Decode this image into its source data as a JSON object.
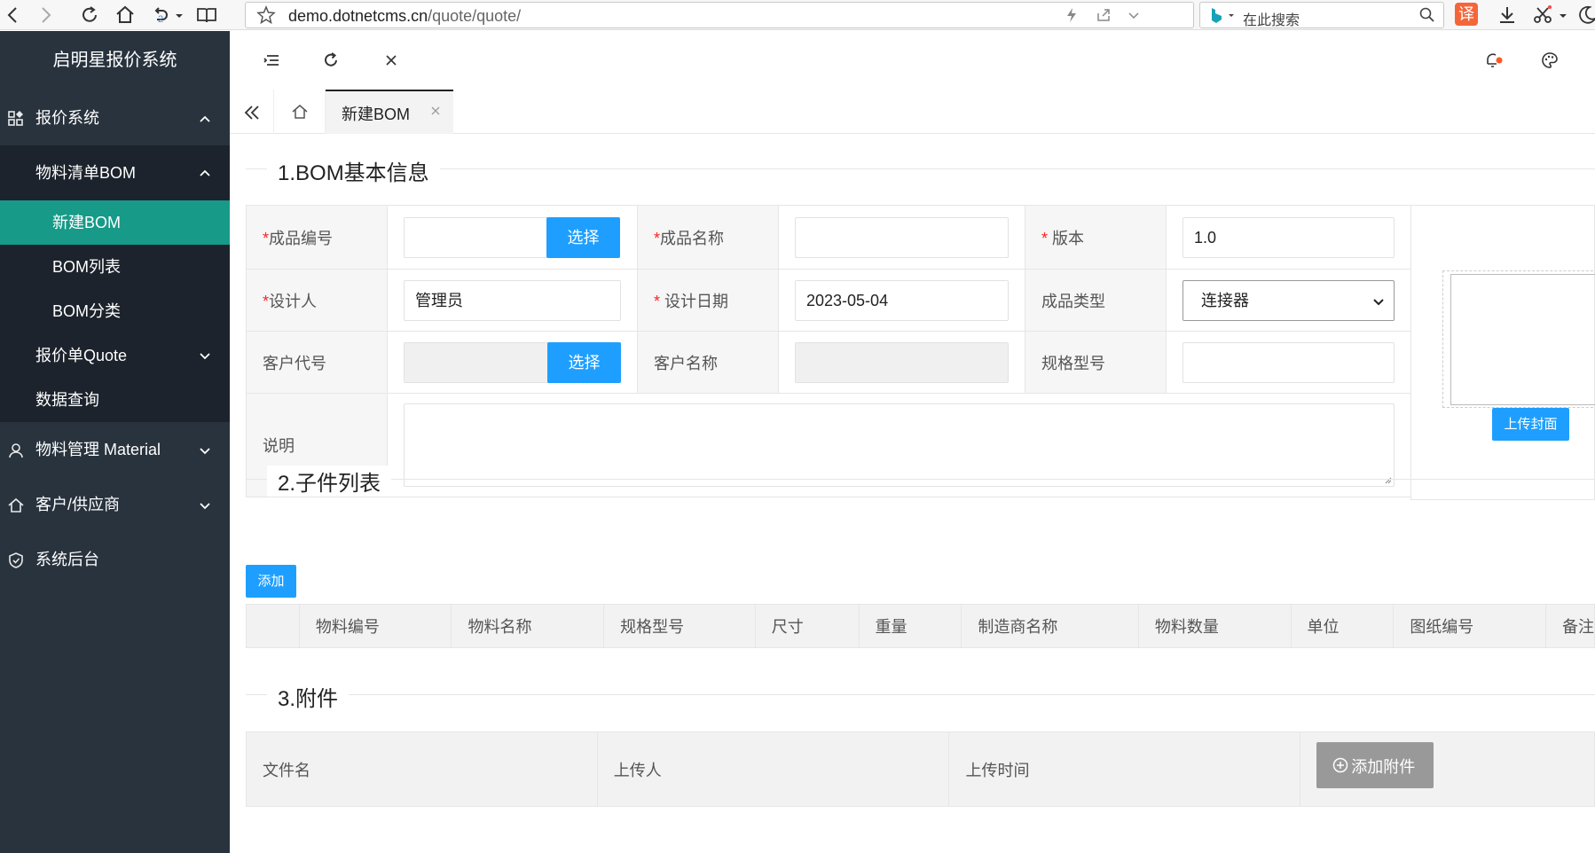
{
  "browser": {
    "url_domain": "demo.dotnetcms.cn",
    "url_path": "/quote/quote/",
    "history_count": "2",
    "search_placeholder": "在此搜索",
    "translate_label": "译"
  },
  "sidebar": {
    "title": "启明星报价系统",
    "menu": {
      "quote_system": "报价系统",
      "bom": "物料清单BOM",
      "new_bom": "新建BOM",
      "bom_list": "BOM列表",
      "bom_category": "BOM分类",
      "quote": "报价单Quote",
      "data_query": "数据查询",
      "material": "物料管理 Material",
      "customer_supplier": "客户/供应商",
      "system_admin": "系统后台"
    }
  },
  "tabs": {
    "active": "新建BOM"
  },
  "section1": {
    "title": "1.BOM基本信息",
    "product_code_label": "成品编号",
    "product_code_value": "",
    "choose_label": "选择",
    "product_name_label": "成品名称",
    "product_name_value": "",
    "version_label": " 版本",
    "version_value": "1.0",
    "designer_label": "设计人",
    "designer_value": "管理员",
    "design_date_label": " 设计日期",
    "design_date_value": "2023-05-04",
    "product_type_label": "成品类型",
    "product_type_value": "连接器",
    "customer_code_label": "客户代号",
    "customer_name_label": "客户名称",
    "spec_model_label": "规格型号",
    "note_label": "说明",
    "upload_cover_label": "上传封面",
    "required_mark": "*"
  },
  "section2": {
    "title": "2.子件列表",
    "add_label": "添加",
    "columns": [
      "物料编号",
      "物料名称",
      "规格型号",
      "尺寸",
      "重量",
      "制造商名称",
      "物料数量",
      "单位",
      "图纸编号",
      "备注"
    ]
  },
  "section3": {
    "title": "3.附件",
    "columns": [
      "文件名",
      "上传人",
      "上传时间"
    ],
    "add_attachment_label": "添加附件"
  },
  "colors": {
    "sidebar_bg": "#28333e",
    "active_item": "#179a88",
    "primary_button": "#1e9fff"
  }
}
